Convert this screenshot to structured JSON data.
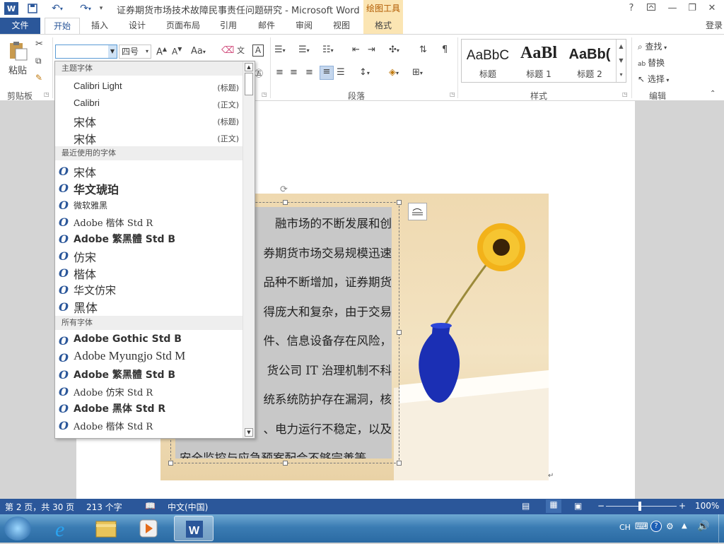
{
  "titlebar": {
    "doc_title": "证券期货市场技术故障民事责任问题研究 - Microsoft Word",
    "context_tool": "绘图工具",
    "help": "?",
    "restore_ribbon": "⌃",
    "minimize": "—",
    "maximize": "❐",
    "close": "✕"
  },
  "tabs": {
    "file": "文件",
    "home": "开始",
    "insert": "插入",
    "design": "设计",
    "layout": "页面布局",
    "references": "引用",
    "mailings": "邮件",
    "review": "审阅",
    "view": "视图",
    "format": "格式",
    "login": "登录"
  },
  "ribbon": {
    "paste": "粘贴",
    "clipboard": "剪贴板",
    "font_name": "",
    "font_size": "四号",
    "change_case": "Aa",
    "paragraph": "段落",
    "styles": "样式",
    "editing": "编辑",
    "find": "查找",
    "replace": "替换",
    "select": "选择",
    "style_items": [
      {
        "sample": "AaBbC",
        "name": "标题"
      },
      {
        "sample": "AaBl",
        "name": "标题 1"
      },
      {
        "sample": "AaBb(",
        "name": "标题 2"
      }
    ]
  },
  "font_dropdown": {
    "theme_header": "主题字体",
    "theme_fonts": [
      {
        "name": "Calibri Light",
        "tag": "(标题)"
      },
      {
        "name": "Calibri",
        "tag": "(正文)"
      },
      {
        "name": "宋体",
        "tag": "(标题)"
      },
      {
        "name": "宋体",
        "tag": "(正文)"
      }
    ],
    "recent_header": "最近使用的字体",
    "recent_fonts": [
      "宋体",
      "华文琥珀",
      "微软雅黑",
      "Adobe 楷体 Std R",
      "Adobe 繁黑體 Std B",
      "仿宋",
      "楷体",
      "华文仿宋",
      "黑体"
    ],
    "all_header": "所有字体",
    "all_fonts": [
      "Adobe Gothic Std B",
      "Adobe Myungjo Std M",
      "Adobe 繁黑體 Std B",
      "Adobe 仿宋 Std R",
      "Adobe 黑体 Std R",
      "Adobe 楷体 Std R"
    ],
    "truetype_glyph": "O"
  },
  "textbox_lines": [
    "融市场的不断发展和创",
    "券期货市场交易规模迅速",
    "品种不断增加，证券期货",
    "得庞大和复杂，由于交易",
    "件、信息设备存在风险，",
    "货公司 IT 治理机制不科",
    "统系统防护存在漏洞，核",
    "、电力运行不稳定，以及",
    "安全监控与应急预案配合不够完善等"
  ],
  "statusbar": {
    "page": "第 2 页，共 30 页",
    "words": "213 个字",
    "language": "中文(中国)",
    "zoom": "100%"
  },
  "taskbar": {
    "tray_lang": "CH"
  },
  "colors": {
    "word_blue": "#2b579a",
    "context_tab": "#fbe5b3"
  }
}
